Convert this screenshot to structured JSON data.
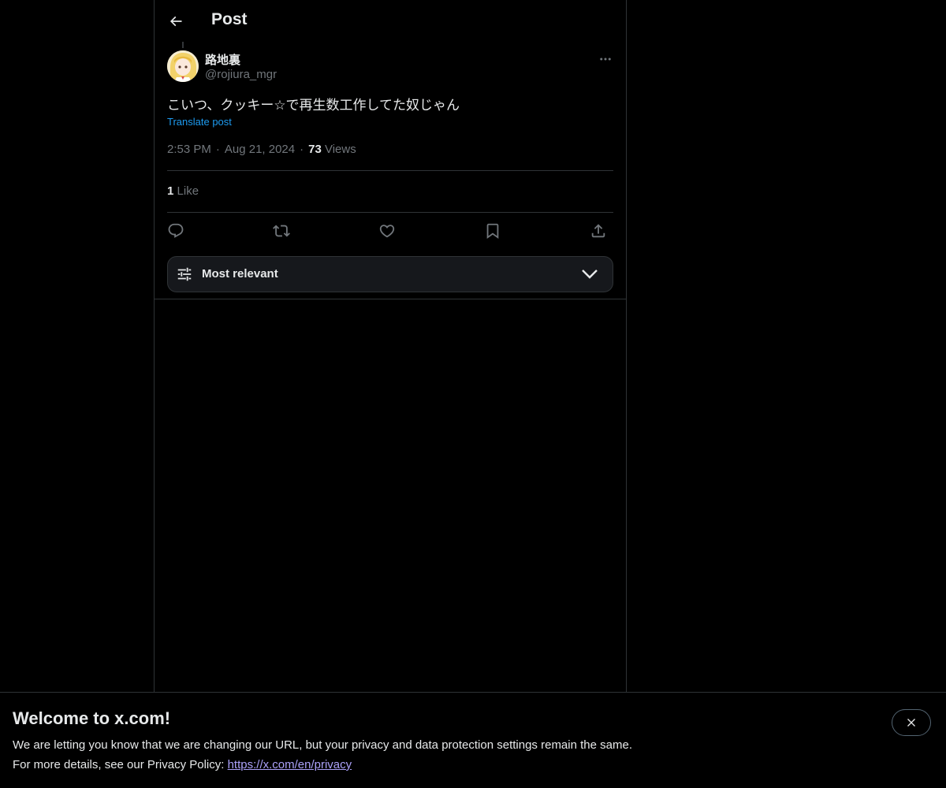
{
  "header": {
    "title": "Post",
    "back_icon": "arrow-left-icon"
  },
  "post": {
    "author": {
      "display_name": "路地裏",
      "handle": "@rojiura_mgr"
    },
    "text": "こいつ、クッキー☆で再生数工作してた奴じゃん",
    "translate_label": "Translate post",
    "time": "2:53 PM",
    "date": "Aug 21, 2024",
    "separator": "·",
    "views_count": "73",
    "views_label": "Views",
    "likes_count": "1",
    "likes_label": "Like"
  },
  "actions": {
    "reply_icon": "reply-icon",
    "repost_icon": "repost-icon",
    "like_icon": "heart-icon",
    "bookmark_icon": "bookmark-icon",
    "share_icon": "share-icon"
  },
  "replies_sort": {
    "label": "Most relevant"
  },
  "banner": {
    "title": "Welcome to x.com!",
    "line1": "We are letting you know that we are changing our URL, but your privacy and data protection settings remain the same.",
    "line2_prefix": "For more details, see our Privacy Policy: ",
    "link_text": "https://x.com/en/privacy"
  },
  "colors": {
    "background": "#000000",
    "text_primary": "#e7e9ea",
    "text_secondary": "#71767b",
    "link": "#1d9bf0",
    "banner_link": "#aba1f9",
    "border": "#2f3336"
  }
}
